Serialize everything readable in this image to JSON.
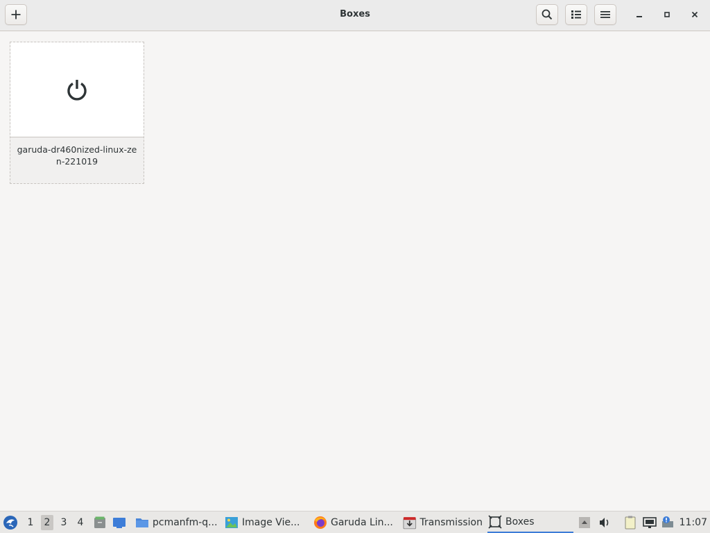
{
  "window": {
    "title": "Boxes"
  },
  "header": {
    "new_icon": "plus-icon",
    "search_icon": "search-icon",
    "view_icon": "list-view-icon",
    "menu_icon": "hamburger-menu-icon"
  },
  "boxes": [
    {
      "name": "garuda-dr460nized-linux-zen-221019",
      "status_icon": "power-icon"
    }
  ],
  "taskbar": {
    "workspaces": [
      "1",
      "2",
      "3",
      "4"
    ],
    "active_workspace": "2",
    "tasks": [
      {
        "label": "pcmanfm-q...",
        "icon": "folder-icon"
      },
      {
        "label": "Image Vie...",
        "icon": "image-viewer-icon"
      },
      {
        "label": "Garuda Lin...",
        "icon": "firefox-icon"
      },
      {
        "label": "Transmission",
        "icon": "transmission-icon"
      },
      {
        "label": "Boxes",
        "icon": "boxes-icon"
      }
    ],
    "clock": "11:07"
  },
  "colors": {
    "accent": "#3d7dd8",
    "window_bg": "#f6f5f4",
    "header_bg": "#ebebeb"
  }
}
